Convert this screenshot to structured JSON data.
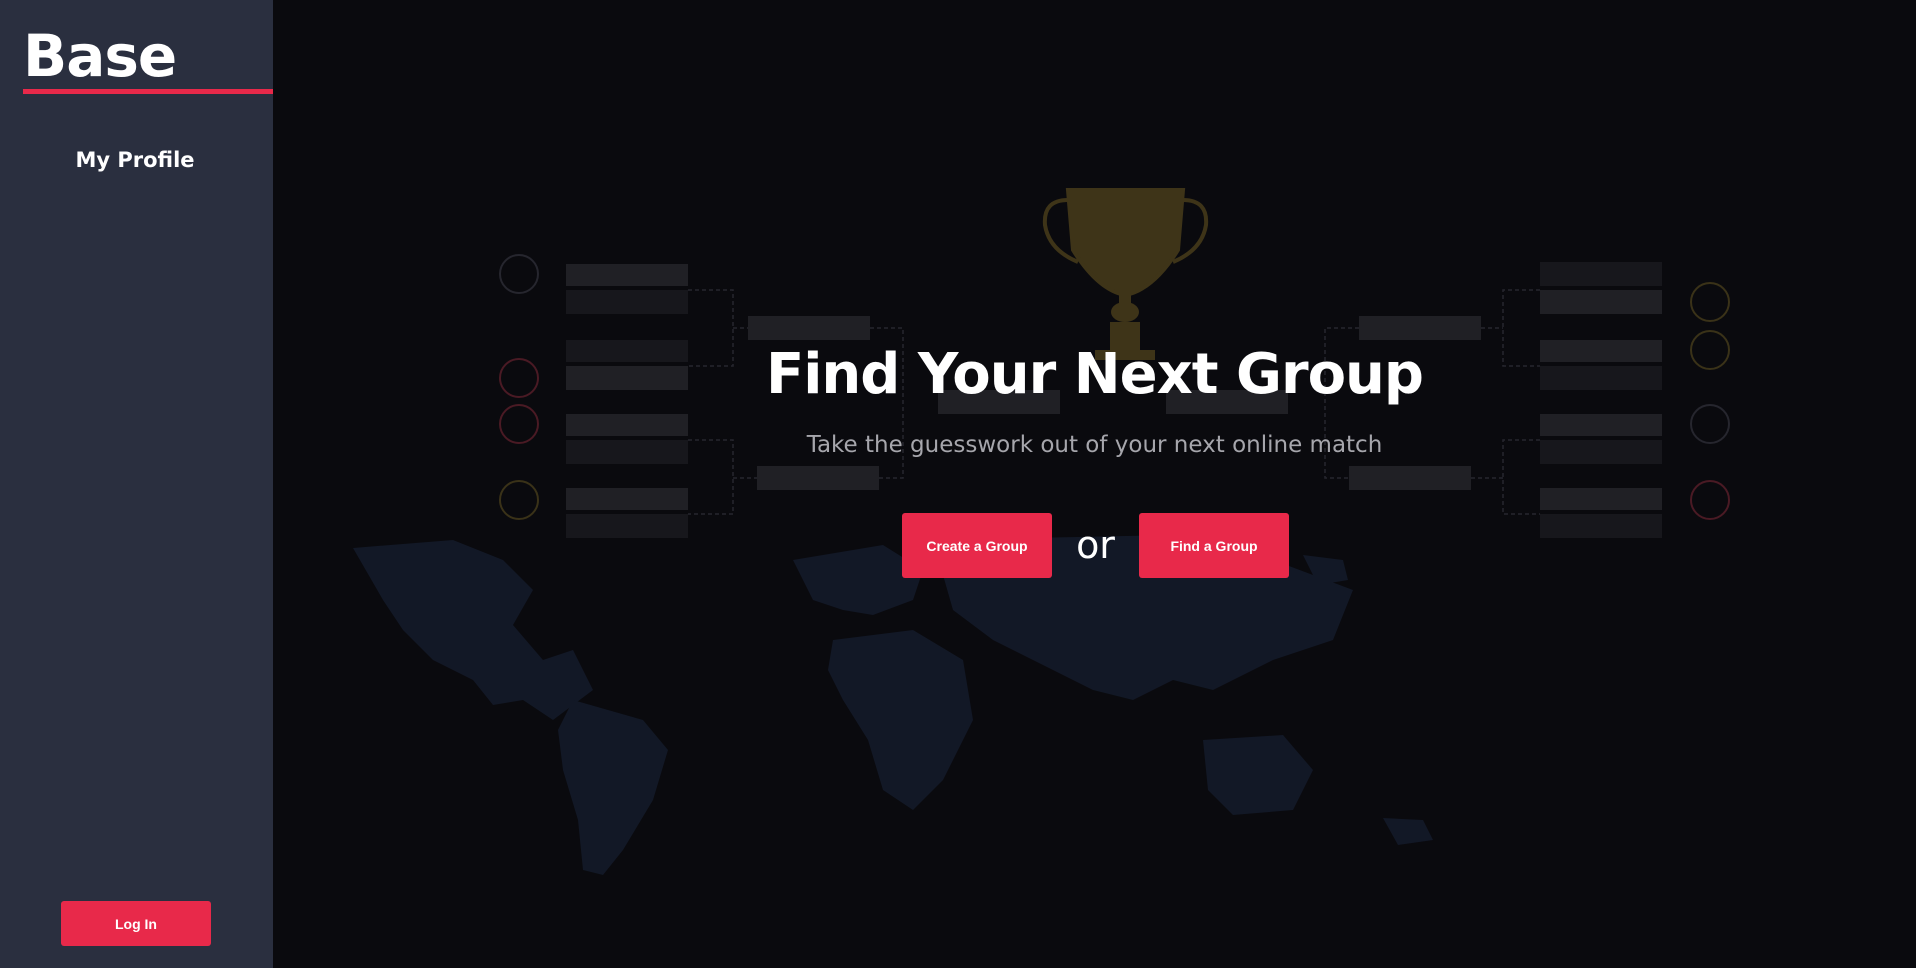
{
  "sidebar": {
    "brand": "Base",
    "nav": {
      "profile_label": "My Profile"
    },
    "login_label": "Log In"
  },
  "hero": {
    "title": "Find Your Next Group",
    "subtitle": "Take the guesswork out of your next online match",
    "create_label": "Create a Group",
    "or_label": "or",
    "find_label": "Find a Group"
  },
  "colors": {
    "accent": "#e8294a",
    "sidebar_bg": "#2a2f3f",
    "main_bg": "#0a0a0e"
  },
  "background_art": {
    "icons": [
      "trophy-icon",
      "tournament-bracket",
      "world-map"
    ]
  }
}
